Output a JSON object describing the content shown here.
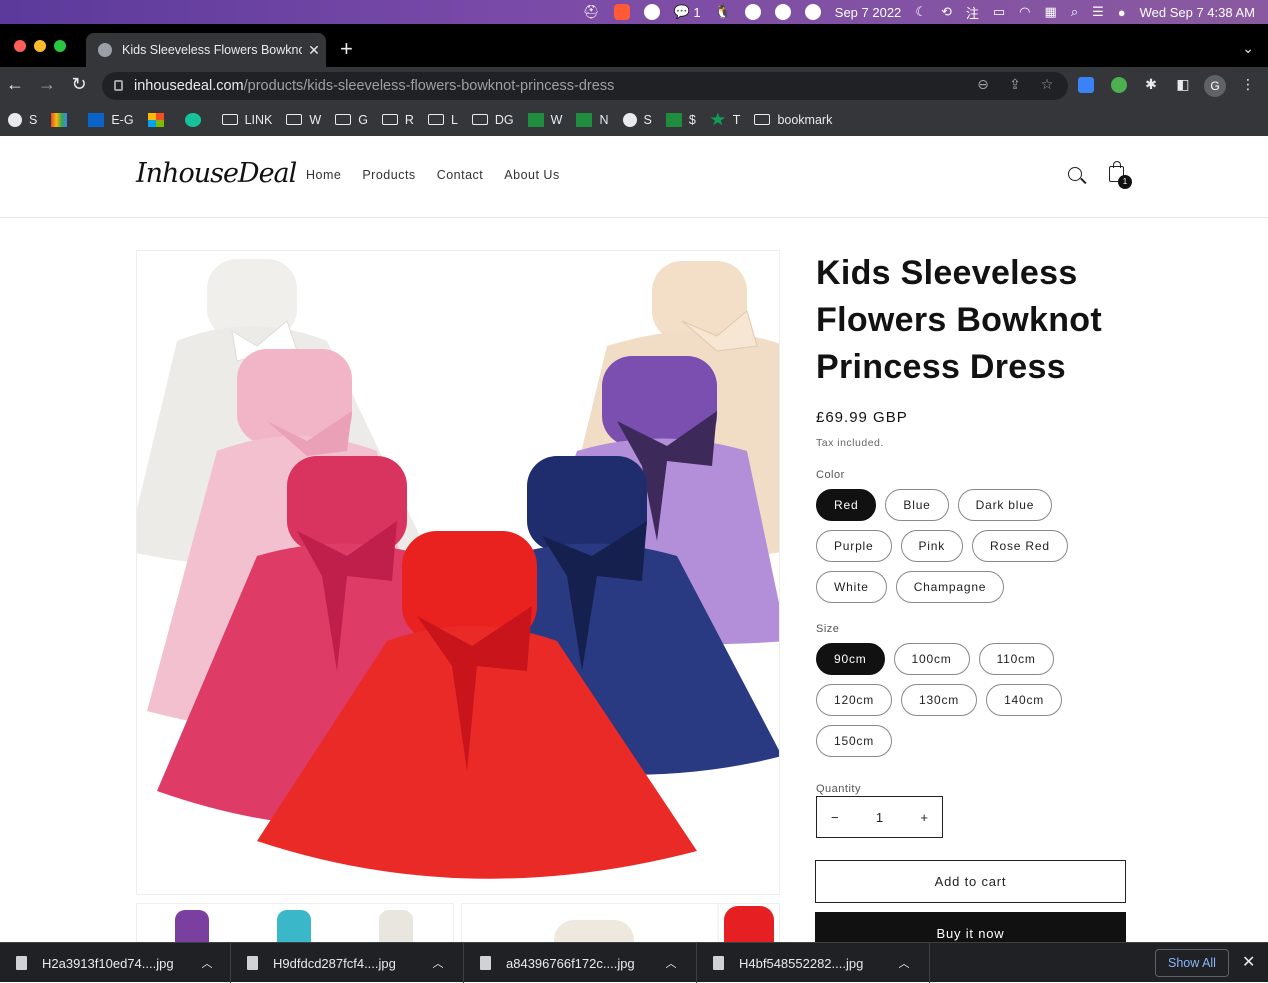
{
  "menubar": {
    "wechat_count": "1",
    "date_short": "Sep 7 2022",
    "datetime": "Wed Sep 7  4:38 AM"
  },
  "browser": {
    "tab_title": "Kids Sleeveless Flowers Bowknot Princess Dress",
    "url_domain": "inhousedeal.com",
    "url_path": "/products/kids-sleeveless-flowers-bowknot-princess-dress",
    "profile_initial": "G",
    "bookmarks": [
      {
        "label": "S",
        "icon": "globe-icon"
      },
      {
        "label": "",
        "icon": "gmail-icon"
      },
      {
        "label": "E-G",
        "icon": "outlook-icon"
      },
      {
        "label": "",
        "icon": "microsoft-icon"
      },
      {
        "label": "",
        "icon": "grammarly-icon"
      },
      {
        "label": "LINK",
        "icon": "folder-icon"
      },
      {
        "label": "W",
        "icon": "folder-icon"
      },
      {
        "label": "G",
        "icon": "folder-icon"
      },
      {
        "label": "R",
        "icon": "folder-icon"
      },
      {
        "label": "L",
        "icon": "folder-icon"
      },
      {
        "label": "DG",
        "icon": "folder-icon"
      },
      {
        "label": "W",
        "icon": "green-cross-icon"
      },
      {
        "label": "N",
        "icon": "green-cross-icon"
      },
      {
        "label": "S",
        "icon": "globe-icon"
      },
      {
        "label": "$",
        "icon": "green-cross-icon"
      },
      {
        "label": "T",
        "icon": "star-icon"
      },
      {
        "label": "bookmark",
        "icon": "folder-icon"
      }
    ]
  },
  "store": {
    "logo": "InhouseDeal",
    "nav": [
      "Home",
      "Products",
      "Contact",
      "About Us"
    ],
    "cart_count": "1"
  },
  "product": {
    "title": "Kids Sleeveless Flowers Bowknot Princess Dress",
    "price": "£69.99 GBP",
    "tax_note": "Tax included.",
    "color_label": "Color",
    "colors": [
      "Red",
      "Blue",
      "Dark blue",
      "Purple",
      "Pink",
      "Rose Red",
      "White",
      "Champagne"
    ],
    "selected_color": "Red",
    "size_label": "Size",
    "sizes": [
      "90cm",
      "100cm",
      "110cm",
      "120cm",
      "130cm",
      "140cm",
      "150cm"
    ],
    "selected_size": "90cm",
    "quantity_label": "Quantity",
    "quantity": "1",
    "minus": "−",
    "plus": "+",
    "add_to_cart": "Add to cart",
    "buy_now": "Buy it now"
  },
  "downloads": {
    "files": [
      "H2a3913f10ed74....jpg",
      "H9dfdcd287fcf4....jpg",
      "a84396766f172c....jpg",
      "H4bf548552282....jpg"
    ],
    "show_all": "Show All"
  },
  "colors": {
    "dress_white": "#f1efec",
    "dress_pink": "#f2b5c8",
    "dress_rose": "#d8345f",
    "dress_red": "#e9211f",
    "dress_navy": "#1f2d6e",
    "dress_purple": "#7b4fb0",
    "dress_champagne": "#f3dfc8"
  }
}
